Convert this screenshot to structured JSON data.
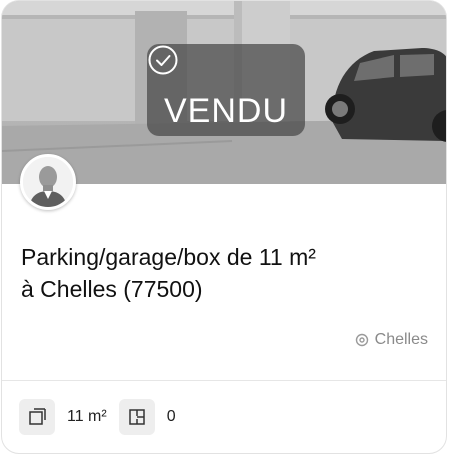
{
  "listing": {
    "status_label": "VENDU",
    "title_line1": "Parking/garage/box de 11 m²",
    "title_line2": "à Chelles (77500)",
    "location": "Chelles",
    "features": [
      {
        "icon": "surface-icon",
        "value": "11 m²"
      },
      {
        "icon": "rooms-icon",
        "value": "0"
      }
    ]
  },
  "icons": {
    "status": "check-circle-icon",
    "location": "location-pin-icon",
    "agent": "avatar"
  },
  "colors": {
    "badge_bg": "#464646",
    "text_primary": "#111111",
    "text_muted": "#8a8a8a",
    "chip_bg": "#eeeeee"
  }
}
